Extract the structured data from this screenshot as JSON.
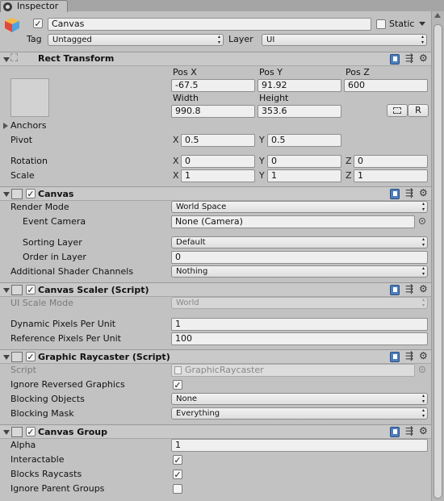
{
  "tab": {
    "title": "Inspector"
  },
  "object": {
    "name": "Canvas",
    "static_label": "Static",
    "tag_label": "Tag",
    "tag_value": "Untagged",
    "layer_label": "Layer",
    "layer_value": "UI"
  },
  "rect_transform": {
    "title": "Rect Transform",
    "pos_x_label": "Pos X",
    "pos_y_label": "Pos Y",
    "pos_z_label": "Pos Z",
    "pos_x": "-67.5",
    "pos_y": "91.92",
    "pos_z": "600",
    "width_label": "Width",
    "height_label": "Height",
    "width": "990.8",
    "height": "353.6",
    "raw_button": "R",
    "anchors_label": "Anchors",
    "pivot_label": "Pivot",
    "pivot_x": "0.5",
    "pivot_y": "0.5",
    "rotation_label": "Rotation",
    "rot_x": "0",
    "rot_y": "0",
    "rot_z": "0",
    "scale_label": "Scale",
    "scale_x": "1",
    "scale_y": "1",
    "scale_z": "1",
    "x": "X",
    "y": "Y",
    "z": "Z"
  },
  "canvas": {
    "title": "Canvas",
    "render_mode_label": "Render Mode",
    "render_mode": "World Space",
    "event_camera_label": "Event Camera",
    "event_camera": "None (Camera)",
    "sorting_layer_label": "Sorting Layer",
    "sorting_layer": "Default",
    "order_label": "Order in Layer",
    "order": "0",
    "shader_label": "Additional Shader Channels",
    "shader": "Nothing"
  },
  "scaler": {
    "title": "Canvas Scaler (Script)",
    "ui_scale_label": "UI Scale Mode",
    "ui_scale": "World",
    "dynamic_label": "Dynamic Pixels Per Unit",
    "dynamic": "1",
    "reference_label": "Reference Pixels Per Unit",
    "reference": "100"
  },
  "raycaster": {
    "title": "Graphic Raycaster (Script)",
    "script_label": "Script",
    "script": "GraphicRaycaster",
    "ignore_reversed_label": "Ignore Reversed Graphics",
    "blocking_objects_label": "Blocking Objects",
    "blocking_objects": "None",
    "blocking_mask_label": "Blocking Mask",
    "blocking_mask": "Everything"
  },
  "group": {
    "title": "Canvas Group",
    "alpha_label": "Alpha",
    "alpha": "1",
    "interactable_label": "Interactable",
    "blocks_label": "Blocks Raycasts",
    "ignore_parent_label": "Ignore Parent Groups"
  },
  "checkmark": "✓",
  "colors": {
    "header": "#c9c9c9",
    "background": "#c2c2c2",
    "help": "#4c7fbf"
  }
}
